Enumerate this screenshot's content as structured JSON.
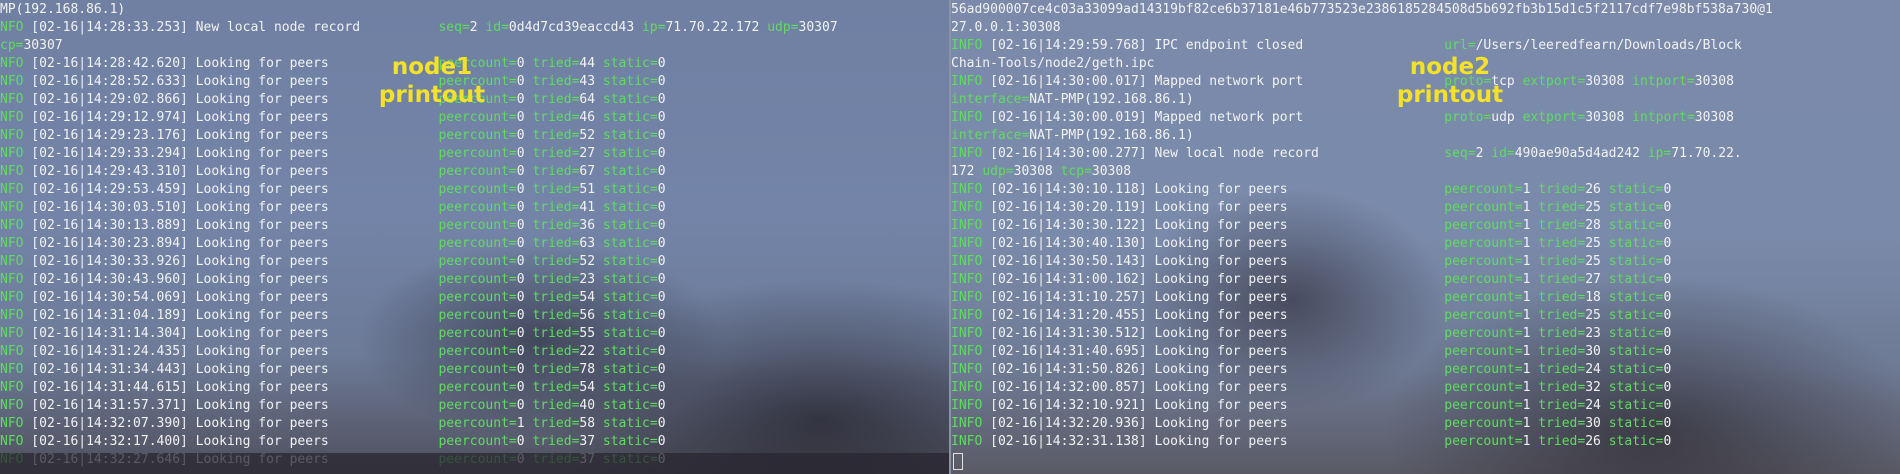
{
  "node1": {
    "label_line1": "node1",
    "label_line2": "printout",
    "header_lines": [
      "MP(192.168.86.1)"
    ],
    "record": {
      "prefix": "NFO",
      "msg": " [02-16|14:28:33.253] New local node record",
      "fields": "seq=2 id=0d4d7cd39eaccd43 ip=71.70.22.172 udp=30307",
      "cont": "cp=30307"
    },
    "peer_lines": [
      {
        "ts": "02-16|14:28:42.620",
        "pc": "0",
        "tried": "44",
        "st": "0"
      },
      {
        "ts": "02-16|14:28:52.633",
        "pc": "0",
        "tried": "43",
        "st": "0"
      },
      {
        "ts": "02-16|14:29:02.866",
        "pc": "0",
        "tried": "64",
        "st": "0"
      },
      {
        "ts": "02-16|14:29:12.974",
        "pc": "0",
        "tried": "46",
        "st": "0"
      },
      {
        "ts": "02-16|14:29:23.176",
        "pc": "0",
        "tried": "52",
        "st": "0"
      },
      {
        "ts": "02-16|14:29:33.294",
        "pc": "0",
        "tried": "27",
        "st": "0"
      },
      {
        "ts": "02-16|14:29:43.310",
        "pc": "0",
        "tried": "67",
        "st": "0"
      },
      {
        "ts": "02-16|14:29:53.459",
        "pc": "0",
        "tried": "51",
        "st": "0"
      },
      {
        "ts": "02-16|14:30:03.510",
        "pc": "0",
        "tried": "41",
        "st": "0"
      },
      {
        "ts": "02-16|14:30:13.889",
        "pc": "0",
        "tried": "36",
        "st": "0"
      },
      {
        "ts": "02-16|14:30:23.894",
        "pc": "0",
        "tried": "63",
        "st": "0"
      },
      {
        "ts": "02-16|14:30:33.926",
        "pc": "0",
        "tried": "52",
        "st": "0"
      },
      {
        "ts": "02-16|14:30:43.960",
        "pc": "0",
        "tried": "23",
        "st": "0"
      },
      {
        "ts": "02-16|14:30:54.069",
        "pc": "0",
        "tried": "54",
        "st": "0"
      },
      {
        "ts": "02-16|14:31:04.189",
        "pc": "0",
        "tried": "56",
        "st": "0"
      },
      {
        "ts": "02-16|14:31:14.304",
        "pc": "0",
        "tried": "55",
        "st": "0"
      },
      {
        "ts": "02-16|14:31:24.435",
        "pc": "0",
        "tried": "22",
        "st": "0"
      },
      {
        "ts": "02-16|14:31:34.443",
        "pc": "0",
        "tried": "78",
        "st": "0"
      },
      {
        "ts": "02-16|14:31:44.615",
        "pc": "0",
        "tried": "54",
        "st": "0"
      },
      {
        "ts": "02-16|14:31:57.371",
        "pc": "0",
        "tried": "40",
        "st": "0"
      },
      {
        "ts": "02-16|14:32:07.390",
        "pc": "1",
        "tried": "58",
        "st": "0"
      },
      {
        "ts": "02-16|14:32:17.400",
        "pc": "0",
        "tried": "37",
        "st": "0"
      },
      {
        "ts": "02-16|14:32:27.646",
        "pc": "0",
        "tried": "37",
        "st": "0"
      }
    ],
    "prefix": "NFO",
    "msg": "Looking for peers"
  },
  "node2": {
    "label_line1": "node2",
    "label_line2": "printout",
    "top_lines": [
      "56ad900007ce4c03a33099ad14319bf82ce6b37181e46b773523e2386185284508d5b692fb3b15d1c5f2117cdf7e98bf538a730@1",
      "27.0.0.1:30308"
    ],
    "ipc_line": {
      "prefix": "INFO",
      "msg": " [02-16|14:29:59.768] IPC endpoint closed",
      "field": "url=/Users/leeredfearn/Downloads/Block",
      "cont": "Chain-Tools/node2/geth.ipc"
    },
    "mapped_tcp": {
      "prefix": "INFO",
      "msg": " [02-16|14:30:00.017] Mapped network port",
      "field": "proto=tcp extport=30308 intport=30308",
      "cont": "interface=NAT-PMP(192.168.86.1)"
    },
    "mapped_udp": {
      "prefix": "INFO",
      "msg": " [02-16|14:30:00.019] Mapped network port",
      "field": "proto=udp extport=30308 intport=30308",
      "cont": "interface=NAT-PMP(192.168.86.1)"
    },
    "record": {
      "prefix": "INFO",
      "msg": " [02-16|14:30:00.277] New local node record",
      "field": "seq=2 id=490ae90a5d4ad242 ip=71.70.22.",
      "cont": "172 udp=30308 tcp=30308"
    },
    "peer_lines": [
      {
        "ts": "02-16|14:30:10.118",
        "pc": "1",
        "tried": "26",
        "st": "0"
      },
      {
        "ts": "02-16|14:30:20.119",
        "pc": "1",
        "tried": "25",
        "st": "0"
      },
      {
        "ts": "02-16|14:30:30.122",
        "pc": "1",
        "tried": "28",
        "st": "0"
      },
      {
        "ts": "02-16|14:30:40.130",
        "pc": "1",
        "tried": "25",
        "st": "0"
      },
      {
        "ts": "02-16|14:30:50.143",
        "pc": "1",
        "tried": "25",
        "st": "0"
      },
      {
        "ts": "02-16|14:31:00.162",
        "pc": "1",
        "tried": "27",
        "st": "0"
      },
      {
        "ts": "02-16|14:31:10.257",
        "pc": "1",
        "tried": "18",
        "st": "0"
      },
      {
        "ts": "02-16|14:31:20.455",
        "pc": "1",
        "tried": "25",
        "st": "0"
      },
      {
        "ts": "02-16|14:31:30.512",
        "pc": "1",
        "tried": "23",
        "st": "0"
      },
      {
        "ts": "02-16|14:31:40.695",
        "pc": "1",
        "tried": "30",
        "st": "0"
      },
      {
        "ts": "02-16|14:31:50.826",
        "pc": "1",
        "tried": "24",
        "st": "0"
      },
      {
        "ts": "02-16|14:32:00.857",
        "pc": "1",
        "tried": "32",
        "st": "0"
      },
      {
        "ts": "02-16|14:32:10.921",
        "pc": "1",
        "tried": "24",
        "st": "0"
      },
      {
        "ts": "02-16|14:32:20.936",
        "pc": "1",
        "tried": "30",
        "st": "0"
      },
      {
        "ts": "02-16|14:32:31.138",
        "pc": "1",
        "tried": "26",
        "st": "0"
      }
    ],
    "prefix": "INFO",
    "msg": "Looking for peers"
  },
  "colors": {
    "log_green": "#5fdc5f",
    "log_white": "#f2f2f2",
    "label_yellow": "#f4e12a"
  },
  "cursor_icon": "terminal-cursor-icon"
}
